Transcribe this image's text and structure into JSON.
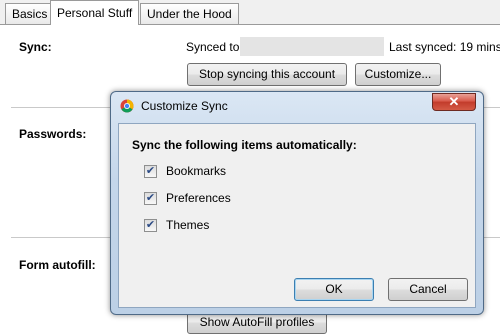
{
  "tabs": [
    {
      "label": "Basics"
    },
    {
      "label": "Personal Stuff"
    },
    {
      "label": "Under the Hood"
    }
  ],
  "sync": {
    "label": "Sync:",
    "synced_to_label": "Synced to",
    "last_synced": "Last synced: 19 mins",
    "stop_button": "Stop syncing this account",
    "customize_button": "Customize..."
  },
  "passwords": {
    "label": "Passwords:"
  },
  "autofill": {
    "label": "Form autofill:",
    "button": "Show AutoFill profiles"
  },
  "dialog": {
    "title": "Customize Sync",
    "close_glyph": "✕",
    "heading": "Sync the following items automatically:",
    "items": [
      {
        "label": "Bookmarks",
        "checked": true
      },
      {
        "label": "Preferences",
        "checked": true
      },
      {
        "label": "Themes",
        "checked": true
      }
    ],
    "ok_label": "OK",
    "cancel_label": "Cancel"
  },
  "icons": {
    "checkmark": "✔",
    "app_icon": "chrome-icon"
  }
}
